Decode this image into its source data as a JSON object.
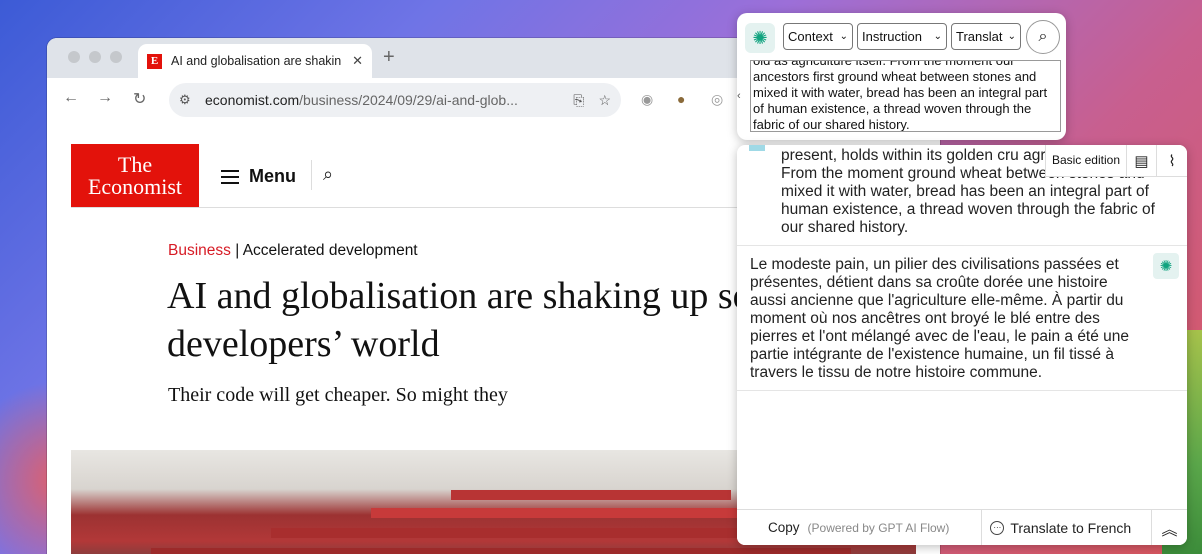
{
  "browser": {
    "tab_favicon": "E",
    "tab_title": "AI and globalisation are shaking",
    "tab_close": "✕",
    "new_tab": "+",
    "url_host": "economist.com",
    "url_path": "/business/2024/09/29/ai-and-glob..."
  },
  "page": {
    "logo_line1": "The",
    "logo_line2": "Economist",
    "menu_label": "Menu",
    "section": "Business",
    "kicker_sep": " | ",
    "kicker": "Accelerated development",
    "headline": "AI and globalisation are shaking up software developers’ world",
    "standfirst": "Their code will get cheaper. So might they"
  },
  "ai_popup": {
    "context_label": "Context",
    "instruction_label": "Instruction",
    "translate_label": "Translat",
    "input_text_cut": "old as agriculture itself. From the moment our",
    "input_text": "ancestors first ground wheat between stones and mixed it with water, bread has been an integral part of human existence, a thread woven through the fabric of our shared history."
  },
  "ai_panel": {
    "basic_edition": "Basic edition",
    "source_text": "present, holds within its golden cru agriculture itself. From the moment ground wheat between stones and mixed it with water, bread has been an integral part of human existence, a thread woven through the fabric of our shared history.",
    "translation": "Le modeste pain, un pilier des civilisations passées et présentes, détient dans sa croûte dorée une histoire aussi ancienne que l'agriculture elle-même. À partir du moment où nos ancêtres ont broyé le blé entre des pierres et l'ont mélangé avec de l'eau, le pain a été une partie intégrante de l'existence humaine, un fil tissé à travers le tissu de notre histoire commune.",
    "copy_label": "Copy",
    "powered_label": "(Powered by GPT AI Flow)",
    "translate_button": "Translate to French"
  }
}
